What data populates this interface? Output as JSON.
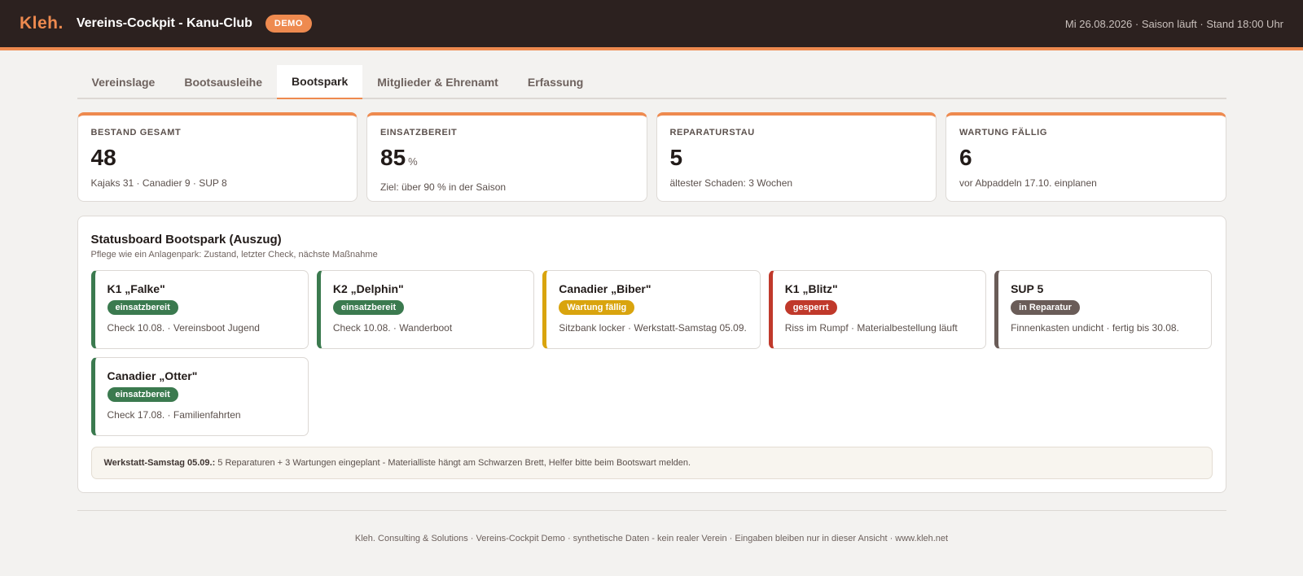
{
  "header": {
    "logo": "Kleh.",
    "title": "Vereins-Cockpit - Kanu-Club",
    "badge": "DEMO",
    "status": "Mi 26.08.2026 · Saison läuft · Stand 18:00 Uhr"
  },
  "tabs": [
    {
      "label": "Vereinslage",
      "active": false
    },
    {
      "label": "Bootsausleihe",
      "active": false
    },
    {
      "label": "Bootspark",
      "active": true
    },
    {
      "label": "Mitglieder & Ehrenamt",
      "active": false
    },
    {
      "label": "Erfassung",
      "active": false
    }
  ],
  "kpis": [
    {
      "label": "BESTAND GESAMT",
      "value": "48",
      "unit": "",
      "sub": "Kajaks 31 · Canadier 9 · SUP 8"
    },
    {
      "label": "EINSATZBEREIT",
      "value": "85",
      "unit": "%",
      "sub": "Ziel: über 90 % in der Saison"
    },
    {
      "label": "REPARATURSTAU",
      "value": "5",
      "unit": "",
      "sub": "ältester Schaden: 3 Wochen"
    },
    {
      "label": "WARTUNG FÄLLIG",
      "value": "6",
      "unit": "",
      "sub": "vor Abpaddeln 17.10. einplanen"
    }
  ],
  "statusboard": {
    "title": "Statusboard Bootspark (Auszug)",
    "subtitle": "Pflege wie ein Anlagenpark: Zustand, letzter Check, nächste Maßnahme",
    "boats": [
      {
        "name": "K1 „Falke\"",
        "status": "einsatzbereit",
        "kind": "einsatz",
        "note": "Check 10.08. · Vereinsboot Jugend"
      },
      {
        "name": "K2 „Delphin\"",
        "status": "einsatzbereit",
        "kind": "einsatz",
        "note": "Check 10.08. · Wanderboot"
      },
      {
        "name": "Canadier „Biber\"",
        "status": "Wartung fällig",
        "kind": "wartung",
        "note": "Sitzbank locker · Werkstatt-Samstag 05.09."
      },
      {
        "name": "K1 „Blitz\"",
        "status": "gesperrt",
        "kind": "gesperrt",
        "note": "Riss im Rumpf · Materialbestellung läuft"
      },
      {
        "name": "SUP 5",
        "status": "in Reparatur",
        "kind": "reparatur",
        "note": "Finnenkasten undicht · fertig bis 30.08."
      },
      {
        "name": "Canadier „Otter\"",
        "status": "einsatzbereit",
        "kind": "einsatz",
        "note": "Check 17.08. · Familienfahrten"
      }
    ],
    "notice_bold": "Werkstatt-Samstag 05.09.:",
    "notice_text": " 5 Reparaturen + 3 Wartungen eingeplant - Materialliste hängt am Schwarzen Brett, Helfer bitte beim Bootswart melden."
  },
  "footer": "Kleh. Consulting & Solutions · Vereins-Cockpit Demo · synthetische Daten - kein realer Verein · Eingaben bleiben nur in dieser Ansicht · www.kleh.net"
}
